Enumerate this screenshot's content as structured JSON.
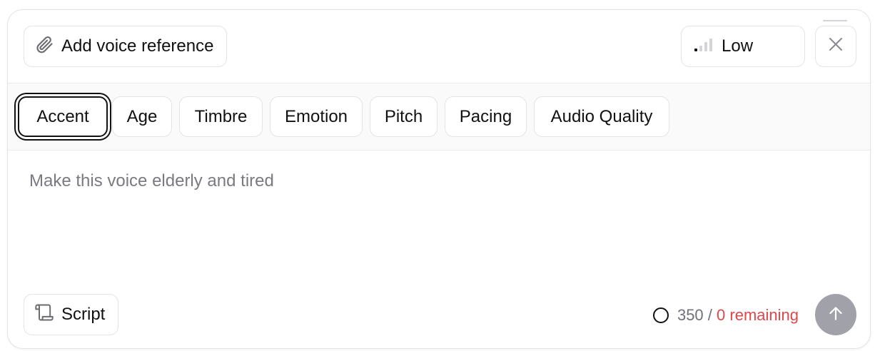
{
  "toolbar": {
    "voice_reference_label": "Add voice reference",
    "quality_label": "Low",
    "close_icon": "close-icon"
  },
  "tags": [
    "Accent",
    "Age",
    "Timbre",
    "Emotion",
    "Pitch",
    "Pacing",
    "Audio Quality"
  ],
  "active_tag": "Accent",
  "prompt": {
    "placeholder": "Make this voice elderly and tired"
  },
  "footer": {
    "script_label": "Script",
    "count": "350",
    "separator": "/",
    "remaining": "0 remaining"
  },
  "colors": {
    "remaining": "#e0464a",
    "send_button": "#a1a1aa",
    "active_outline": "#111111"
  },
  "icons": {
    "voice_reference": "paperclip-icon",
    "quality": "signal-bars-icon",
    "script": "scroll-icon",
    "send": "arrow-up-icon",
    "counter": "circle-icon"
  }
}
